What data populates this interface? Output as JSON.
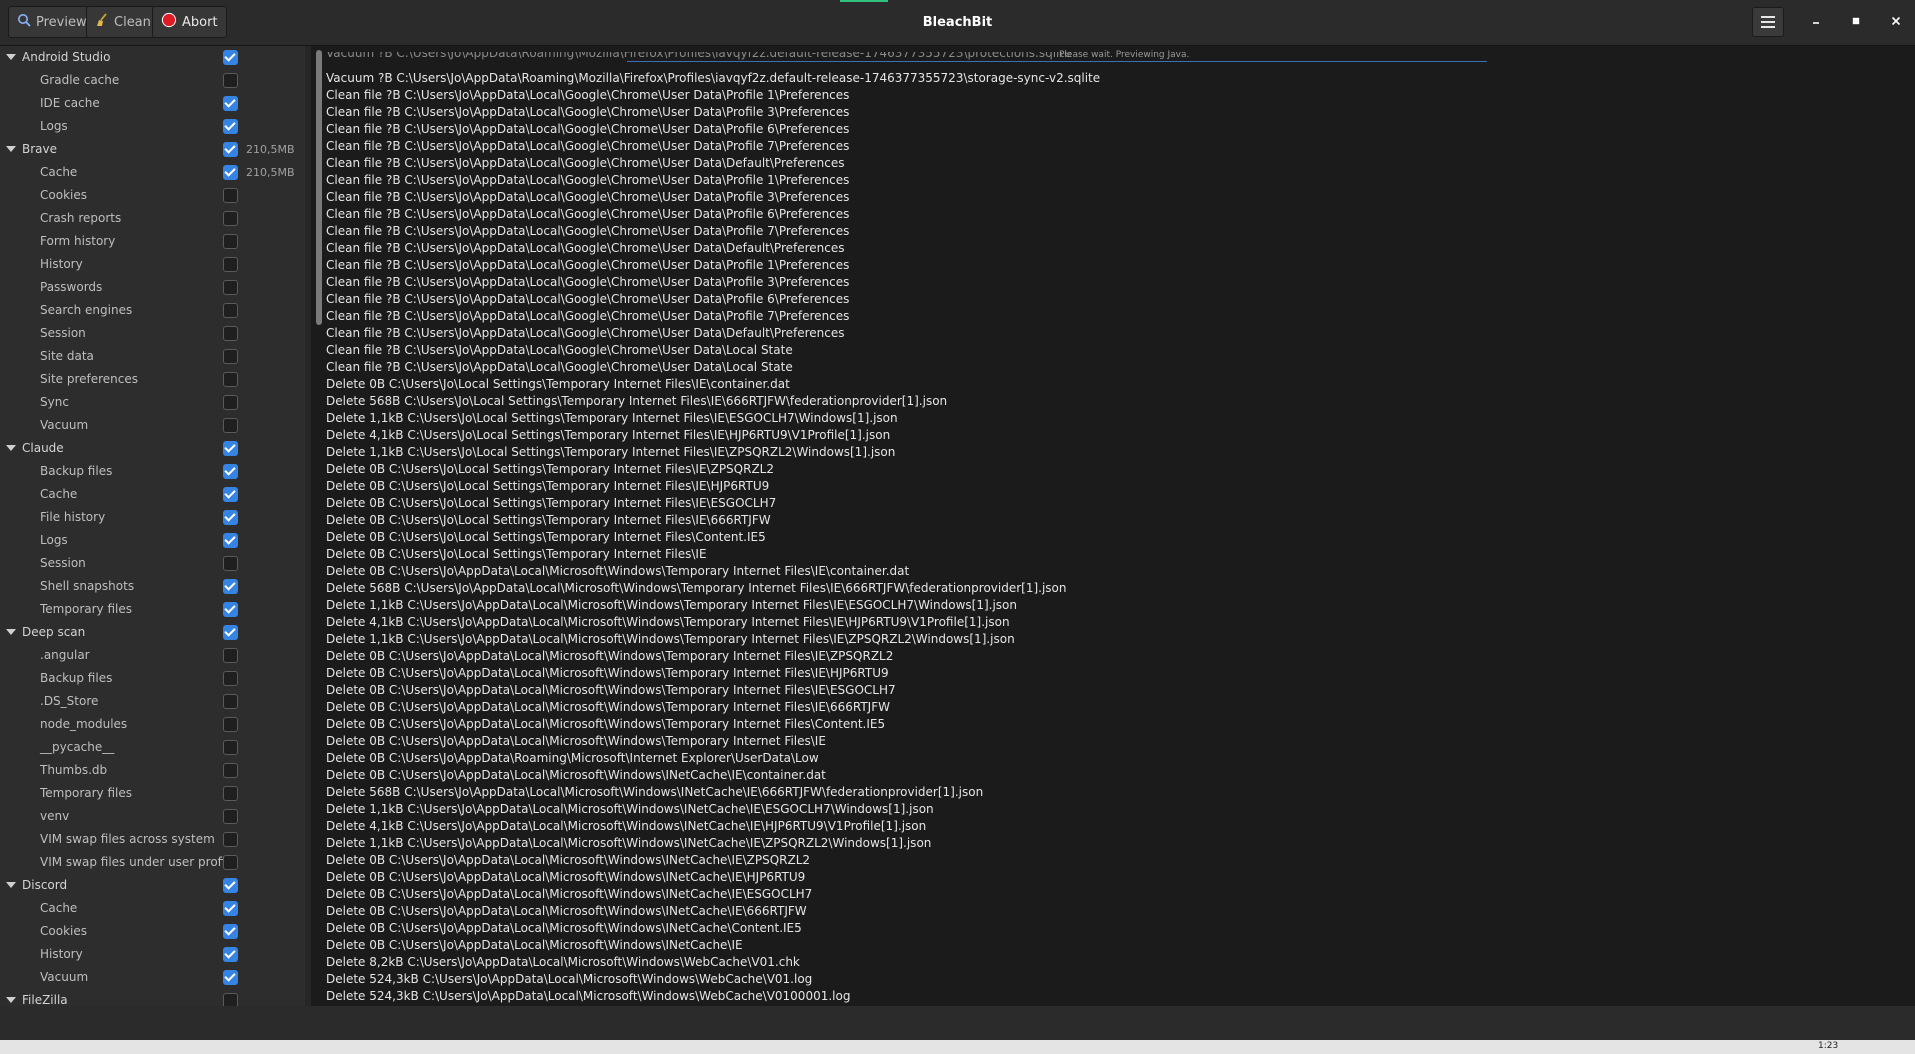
{
  "window": {
    "title": "BleachBit"
  },
  "toolbar": {
    "preview_label": "Preview",
    "clean_label": "Clean",
    "abort_label": "Abort"
  },
  "status_text": "Please wait.  Previewing Java.",
  "tree": [
    {
      "type": "parent",
      "label": "Android Studio",
      "checked": true
    },
    {
      "type": "child",
      "label": "Gradle cache",
      "checked": false
    },
    {
      "type": "child",
      "label": "IDE cache",
      "checked": true
    },
    {
      "type": "child",
      "label": "Logs",
      "checked": true
    },
    {
      "type": "parent",
      "label": "Brave",
      "checked": true,
      "size": "210,5MB"
    },
    {
      "type": "child",
      "label": "Cache",
      "checked": true,
      "size": "210,5MB"
    },
    {
      "type": "child",
      "label": "Cookies",
      "checked": false
    },
    {
      "type": "child",
      "label": "Crash reports",
      "checked": false
    },
    {
      "type": "child",
      "label": "Form history",
      "checked": false
    },
    {
      "type": "child",
      "label": "History",
      "checked": false
    },
    {
      "type": "child",
      "label": "Passwords",
      "checked": false
    },
    {
      "type": "child",
      "label": "Search engines",
      "checked": false
    },
    {
      "type": "child",
      "label": "Session",
      "checked": false
    },
    {
      "type": "child",
      "label": "Site data",
      "checked": false
    },
    {
      "type": "child",
      "label": "Site preferences",
      "checked": false
    },
    {
      "type": "child",
      "label": "Sync",
      "checked": false
    },
    {
      "type": "child",
      "label": "Vacuum",
      "checked": false
    },
    {
      "type": "parent",
      "label": "Claude",
      "checked": true
    },
    {
      "type": "child",
      "label": "Backup files",
      "checked": true
    },
    {
      "type": "child",
      "label": "Cache",
      "checked": true
    },
    {
      "type": "child",
      "label": "File history",
      "checked": true
    },
    {
      "type": "child",
      "label": "Logs",
      "checked": true
    },
    {
      "type": "child",
      "label": "Session",
      "checked": false
    },
    {
      "type": "child",
      "label": "Shell snapshots",
      "checked": true
    },
    {
      "type": "child",
      "label": "Temporary files",
      "checked": true
    },
    {
      "type": "parent",
      "label": "Deep scan",
      "checked": true
    },
    {
      "type": "child",
      "label": ".angular",
      "checked": false
    },
    {
      "type": "child",
      "label": "Backup files",
      "checked": false
    },
    {
      "type": "child",
      "label": ".DS_Store",
      "checked": false
    },
    {
      "type": "child",
      "label": "node_modules",
      "checked": false
    },
    {
      "type": "child",
      "label": "__pycache__",
      "checked": false
    },
    {
      "type": "child",
      "label": "Thumbs.db",
      "checked": false
    },
    {
      "type": "child",
      "label": "Temporary files",
      "checked": false
    },
    {
      "type": "child",
      "label": "venv",
      "checked": false
    },
    {
      "type": "child",
      "label": "VIM swap files across system",
      "checked": false
    },
    {
      "type": "child",
      "label": "VIM swap files under user profile",
      "checked": false
    },
    {
      "type": "parent",
      "label": "Discord",
      "checked": true
    },
    {
      "type": "child",
      "label": "Cache",
      "checked": true
    },
    {
      "type": "child",
      "label": "Cookies",
      "checked": true
    },
    {
      "type": "child",
      "label": "History",
      "checked": true
    },
    {
      "type": "child",
      "label": "Vacuum",
      "checked": true
    },
    {
      "type": "parent",
      "label": "FileZilla",
      "checked": false
    }
  ],
  "log": [
    "Vacuum ?B C:\\Users\\Jo\\AppData\\Roaming\\Mozilla\\Firefox\\Profiles\\iavqyf2z.default-release-1746377355723\\storage-sync-v2.sqlite",
    "Clean file ?B C:\\Users\\Jo\\AppData\\Local\\Google\\Chrome\\User Data\\Profile 1\\Preferences",
    "Clean file ?B C:\\Users\\Jo\\AppData\\Local\\Google\\Chrome\\User Data\\Profile 3\\Preferences",
    "Clean file ?B C:\\Users\\Jo\\AppData\\Local\\Google\\Chrome\\User Data\\Profile 6\\Preferences",
    "Clean file ?B C:\\Users\\Jo\\AppData\\Local\\Google\\Chrome\\User Data\\Profile 7\\Preferences",
    "Clean file ?B C:\\Users\\Jo\\AppData\\Local\\Google\\Chrome\\User Data\\Default\\Preferences",
    "Clean file ?B C:\\Users\\Jo\\AppData\\Local\\Google\\Chrome\\User Data\\Profile 1\\Preferences",
    "Clean file ?B C:\\Users\\Jo\\AppData\\Local\\Google\\Chrome\\User Data\\Profile 3\\Preferences",
    "Clean file ?B C:\\Users\\Jo\\AppData\\Local\\Google\\Chrome\\User Data\\Profile 6\\Preferences",
    "Clean file ?B C:\\Users\\Jo\\AppData\\Local\\Google\\Chrome\\User Data\\Profile 7\\Preferences",
    "Clean file ?B C:\\Users\\Jo\\AppData\\Local\\Google\\Chrome\\User Data\\Default\\Preferences",
    "Clean file ?B C:\\Users\\Jo\\AppData\\Local\\Google\\Chrome\\User Data\\Profile 1\\Preferences",
    "Clean file ?B C:\\Users\\Jo\\AppData\\Local\\Google\\Chrome\\User Data\\Profile 3\\Preferences",
    "Clean file ?B C:\\Users\\Jo\\AppData\\Local\\Google\\Chrome\\User Data\\Profile 6\\Preferences",
    "Clean file ?B C:\\Users\\Jo\\AppData\\Local\\Google\\Chrome\\User Data\\Profile 7\\Preferences",
    "Clean file ?B C:\\Users\\Jo\\AppData\\Local\\Google\\Chrome\\User Data\\Default\\Preferences",
    "Clean file ?B C:\\Users\\Jo\\AppData\\Local\\Google\\Chrome\\User Data\\Local State",
    "Clean file ?B C:\\Users\\Jo\\AppData\\Local\\Google\\Chrome\\User Data\\Local State",
    "Delete 0B C:\\Users\\Jo\\Local Settings\\Temporary Internet Files\\IE\\container.dat",
    "Delete 568B C:\\Users\\Jo\\Local Settings\\Temporary Internet Files\\IE\\666RTJFW\\federationprovider[1].json",
    "Delete 1,1kB C:\\Users\\Jo\\Local Settings\\Temporary Internet Files\\IE\\ESGOCLH7\\Windows[1].json",
    "Delete 4,1kB C:\\Users\\Jo\\Local Settings\\Temporary Internet Files\\IE\\HJP6RTU9\\V1Profile[1].json",
    "Delete 1,1kB C:\\Users\\Jo\\Local Settings\\Temporary Internet Files\\IE\\ZPSQRZL2\\Windows[1].json",
    "Delete 0B C:\\Users\\Jo\\Local Settings\\Temporary Internet Files\\IE\\ZPSQRZL2",
    "Delete 0B C:\\Users\\Jo\\Local Settings\\Temporary Internet Files\\IE\\HJP6RTU9",
    "Delete 0B C:\\Users\\Jo\\Local Settings\\Temporary Internet Files\\IE\\ESGOCLH7",
    "Delete 0B C:\\Users\\Jo\\Local Settings\\Temporary Internet Files\\IE\\666RTJFW",
    "Delete 0B C:\\Users\\Jo\\Local Settings\\Temporary Internet Files\\Content.IE5",
    "Delete 0B C:\\Users\\Jo\\Local Settings\\Temporary Internet Files\\IE",
    "Delete 0B C:\\Users\\Jo\\AppData\\Local\\Microsoft\\Windows\\Temporary Internet Files\\IE\\container.dat",
    "Delete 568B C:\\Users\\Jo\\AppData\\Local\\Microsoft\\Windows\\Temporary Internet Files\\IE\\666RTJFW\\federationprovider[1].json",
    "Delete 1,1kB C:\\Users\\Jo\\AppData\\Local\\Microsoft\\Windows\\Temporary Internet Files\\IE\\ESGOCLH7\\Windows[1].json",
    "Delete 4,1kB C:\\Users\\Jo\\AppData\\Local\\Microsoft\\Windows\\Temporary Internet Files\\IE\\HJP6RTU9\\V1Profile[1].json",
    "Delete 1,1kB C:\\Users\\Jo\\AppData\\Local\\Microsoft\\Windows\\Temporary Internet Files\\IE\\ZPSQRZL2\\Windows[1].json",
    "Delete 0B C:\\Users\\Jo\\AppData\\Local\\Microsoft\\Windows\\Temporary Internet Files\\IE\\ZPSQRZL2",
    "Delete 0B C:\\Users\\Jo\\AppData\\Local\\Microsoft\\Windows\\Temporary Internet Files\\IE\\HJP6RTU9",
    "Delete 0B C:\\Users\\Jo\\AppData\\Local\\Microsoft\\Windows\\Temporary Internet Files\\IE\\ESGOCLH7",
    "Delete 0B C:\\Users\\Jo\\AppData\\Local\\Microsoft\\Windows\\Temporary Internet Files\\IE\\666RTJFW",
    "Delete 0B C:\\Users\\Jo\\AppData\\Local\\Microsoft\\Windows\\Temporary Internet Files\\Content.IE5",
    "Delete 0B C:\\Users\\Jo\\AppData\\Local\\Microsoft\\Windows\\Temporary Internet Files\\IE",
    "Delete 0B C:\\Users\\Jo\\AppData\\Roaming\\Microsoft\\Internet Explorer\\UserData\\Low",
    "Delete 0B C:\\Users\\Jo\\AppData\\Local\\Microsoft\\Windows\\INetCache\\IE\\container.dat",
    "Delete 568B C:\\Users\\Jo\\AppData\\Local\\Microsoft\\Windows\\INetCache\\IE\\666RTJFW\\federationprovider[1].json",
    "Delete 1,1kB C:\\Users\\Jo\\AppData\\Local\\Microsoft\\Windows\\INetCache\\IE\\ESGOCLH7\\Windows[1].json",
    "Delete 4,1kB C:\\Users\\Jo\\AppData\\Local\\Microsoft\\Windows\\INetCache\\IE\\HJP6RTU9\\V1Profile[1].json",
    "Delete 1,1kB C:\\Users\\Jo\\AppData\\Local\\Microsoft\\Windows\\INetCache\\IE\\ZPSQRZL2\\Windows[1].json",
    "Delete 0B C:\\Users\\Jo\\AppData\\Local\\Microsoft\\Windows\\INetCache\\IE\\ZPSQRZL2",
    "Delete 0B C:\\Users\\Jo\\AppData\\Local\\Microsoft\\Windows\\INetCache\\IE\\HJP6RTU9",
    "Delete 0B C:\\Users\\Jo\\AppData\\Local\\Microsoft\\Windows\\INetCache\\IE\\ESGOCLH7",
    "Delete 0B C:\\Users\\Jo\\AppData\\Local\\Microsoft\\Windows\\INetCache\\IE\\666RTJFW",
    "Delete 0B C:\\Users\\Jo\\AppData\\Local\\Microsoft\\Windows\\INetCache\\Content.IE5",
    "Delete 0B C:\\Users\\Jo\\AppData\\Local\\Microsoft\\Windows\\INetCache\\IE",
    "Delete 8,2kB C:\\Users\\Jo\\AppData\\Local\\Microsoft\\Windows\\WebCache\\V01.chk",
    "Delete 524,3kB C:\\Users\\Jo\\AppData\\Local\\Microsoft\\Windows\\WebCache\\V01.log",
    "Delete 524,3kB C:\\Users\\Jo\\AppData\\Local\\Microsoft\\Windows\\WebCache\\V0100001.log"
  ],
  "taskbar": {
    "clock": "1:23"
  },
  "colors": {
    "accent": "#3584e4",
    "abort_icon": "#e01b24",
    "progress": "#2ec27e"
  }
}
